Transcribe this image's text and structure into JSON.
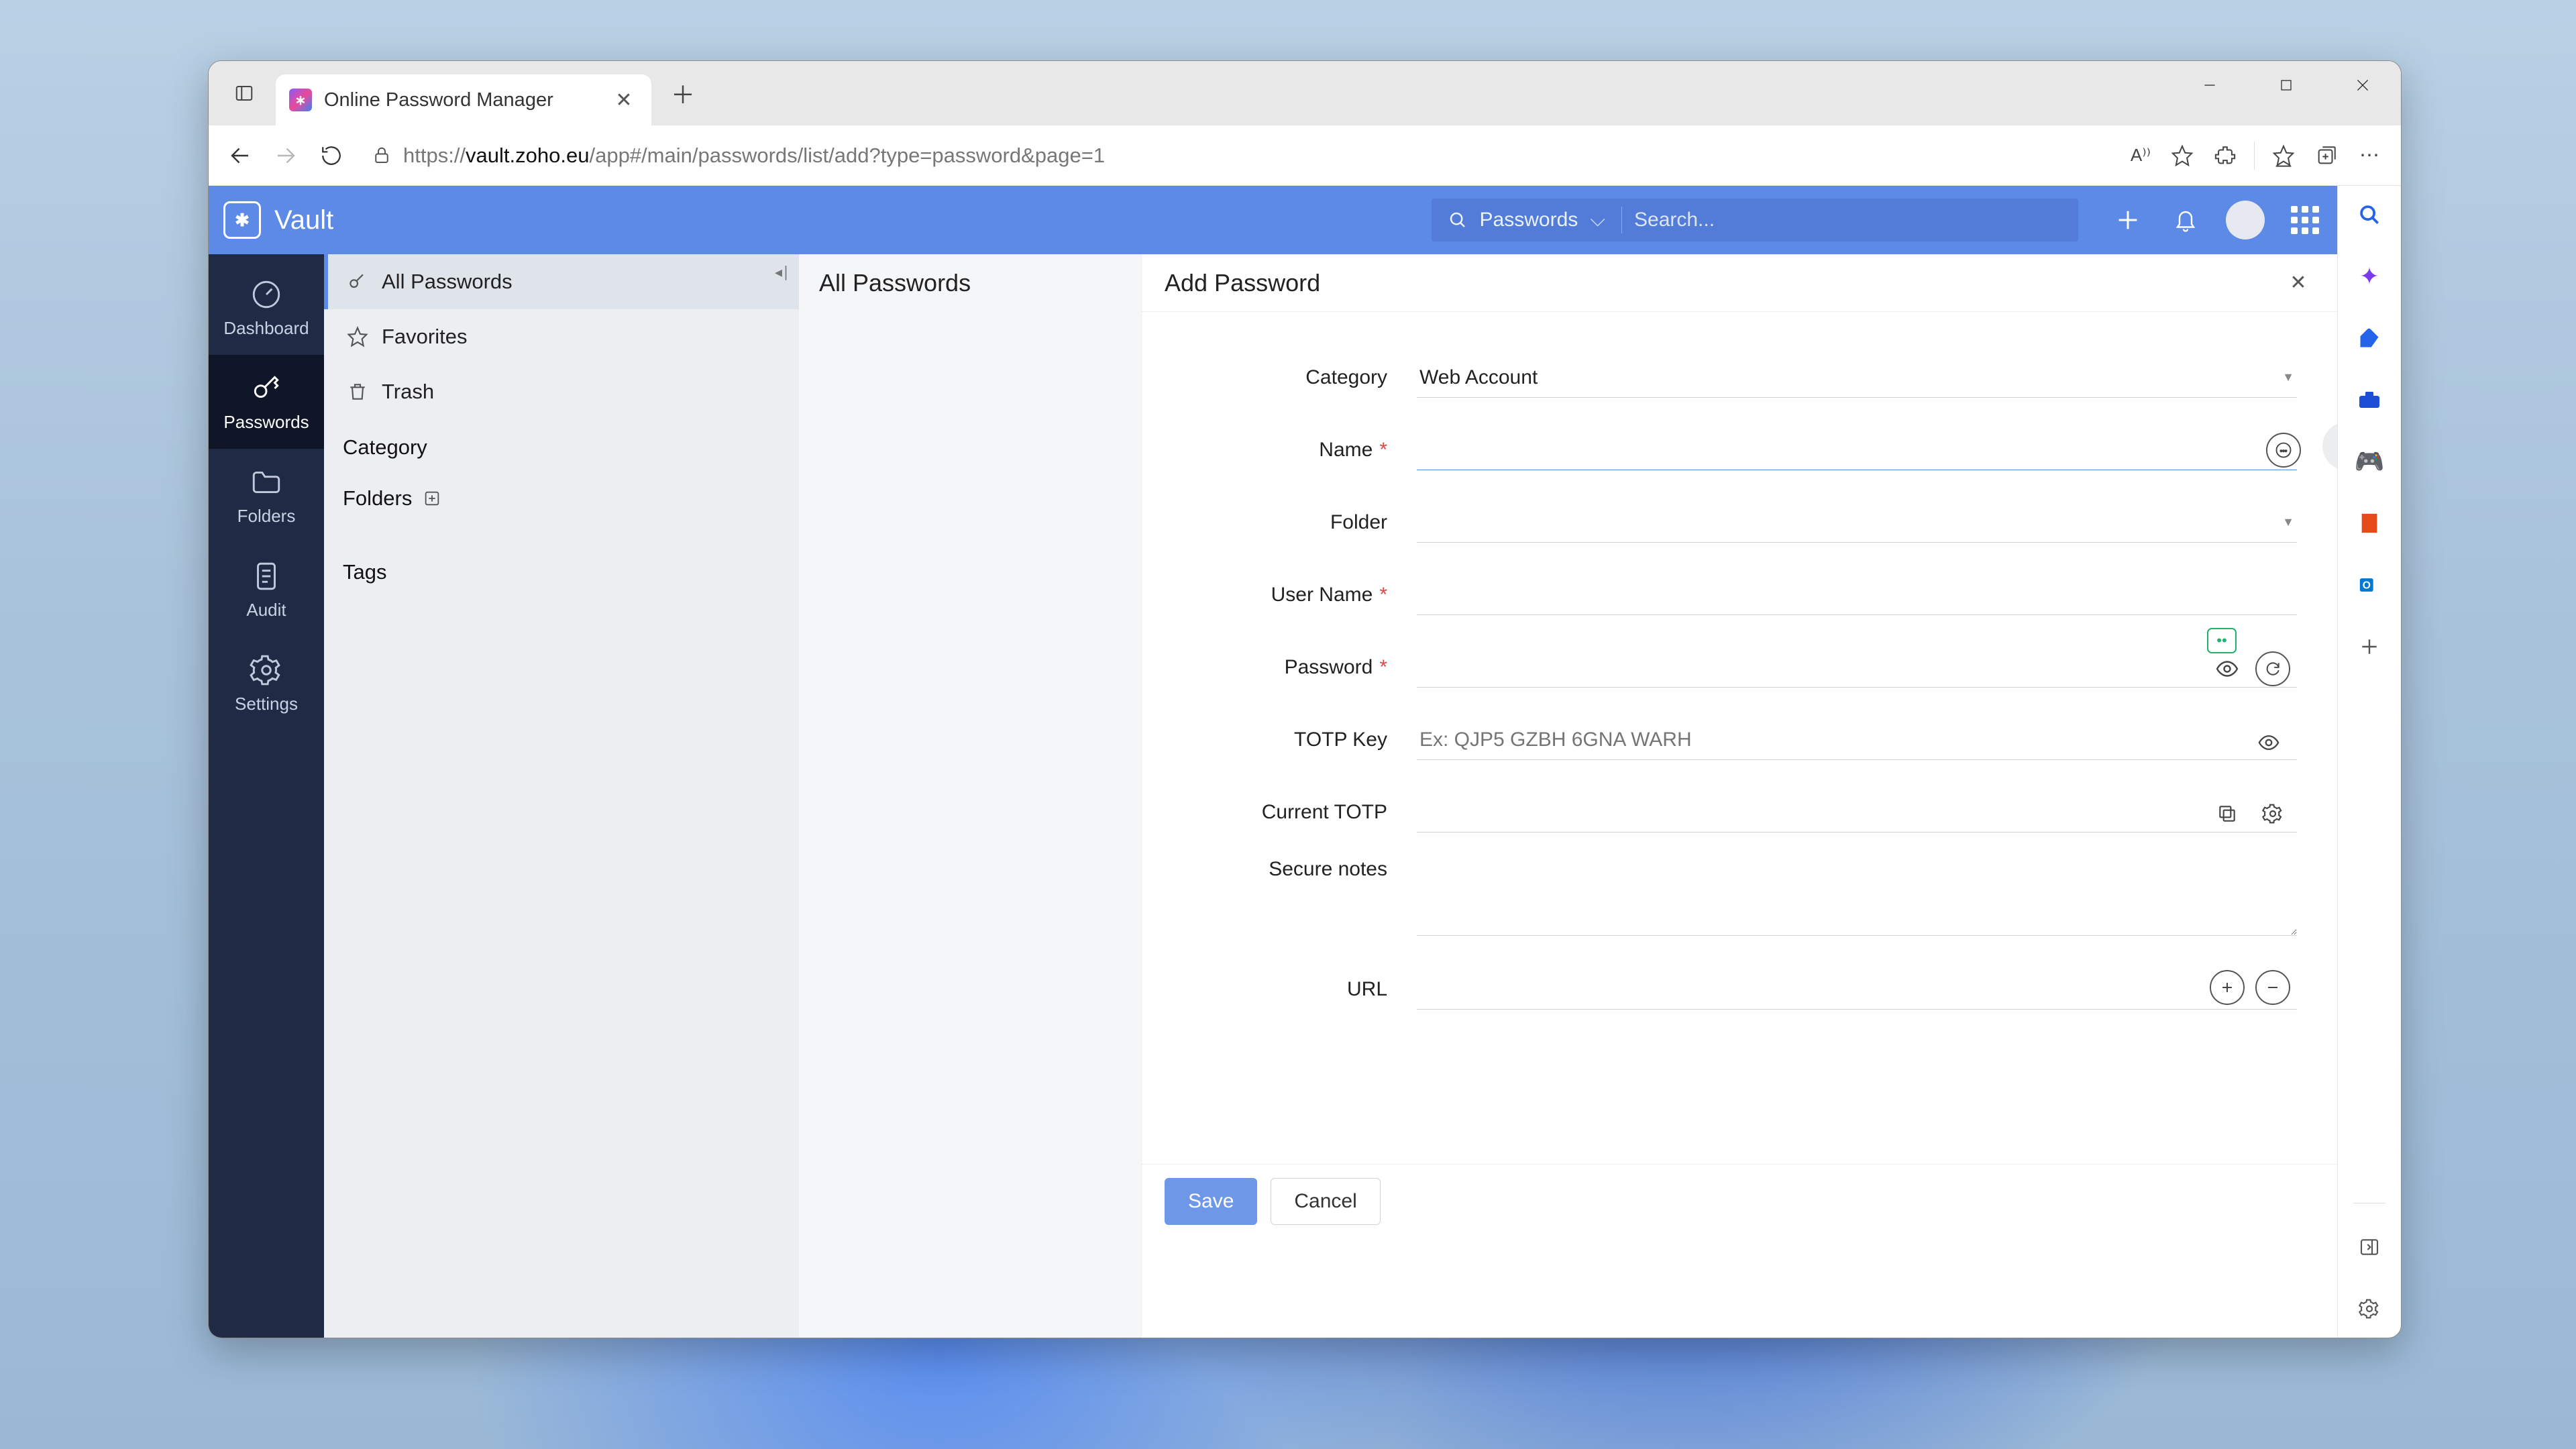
{
  "browser": {
    "tab_title": "Online Password Manager",
    "url_host": "vault.zoho.eu",
    "url_prefix": "https://",
    "url_path": "/app#/main/passwords/list/add?type=password&page=1",
    "read_aloud_badge": "A⁾⁾"
  },
  "app": {
    "brand": "Vault",
    "search_scope": "Passwords",
    "search_placeholder": "Search..."
  },
  "rail": {
    "dashboard": "Dashboard",
    "passwords": "Passwords",
    "folders": "Folders",
    "audit": "Audit",
    "settings": "Settings"
  },
  "subnav": {
    "all": "All Passwords",
    "favorites": "Favorites",
    "trash": "Trash",
    "category": "Category",
    "folders": "Folders",
    "tags": "Tags"
  },
  "list": {
    "header": "All Passwords"
  },
  "panel": {
    "title": "Add Password",
    "fields": {
      "category_label": "Category",
      "category_value": "Web Account",
      "name_label": "Name",
      "folder_label": "Folder",
      "username_label": "User Name",
      "password_label": "Password",
      "totpkey_label": "TOTP Key",
      "totpkey_placeholder": "Ex: QJP5 GZBH 6GNA WARH",
      "currenttotp_label": "Current TOTP",
      "secure_label": "Secure notes",
      "url_label": "URL"
    },
    "save": "Save",
    "cancel": "Cancel"
  }
}
